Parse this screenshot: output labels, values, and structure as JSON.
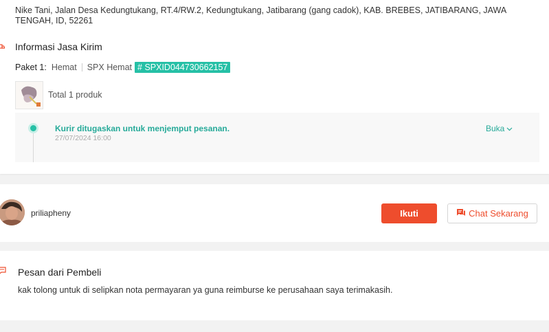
{
  "shipping": {
    "address": "Nike Tani, Jalan Desa Kedungtukang, RT.4/RW.2, Kedungtukang, Jatibarang (gang cadok), KAB. BREBES, JATIBARANG, JAWA TENGAH, ID, 52261",
    "title": "Informasi Jasa Kirim",
    "package_label": "Paket 1:",
    "service_type": "Hemat",
    "courier": "SPX Hemat",
    "tracking_number": "# SPXID044730662157",
    "total_products": "Total 1 produk",
    "timeline": {
      "status": "Kurir ditugaskan untuk menjemput pesanan.",
      "timestamp": "27/07/2024 16:00",
      "expand_label": "Buka"
    }
  },
  "buyer": {
    "username": "priliapheny",
    "follow_label": "Ikuti",
    "chat_label": "Chat Sekarang"
  },
  "message": {
    "title": "Pesan dari Pembeli",
    "body": "kak tolong untuk di selipkan nota permayaran ya guna reimburse ke perusahaan saya terimakasih."
  },
  "colors": {
    "accent": "#ee4d2d",
    "teal": "#26aa99",
    "tracking_badge": "#26c0a6"
  },
  "icons": [
    "truck-icon",
    "chevron-down-icon",
    "chat-icon",
    "message-icon"
  ]
}
